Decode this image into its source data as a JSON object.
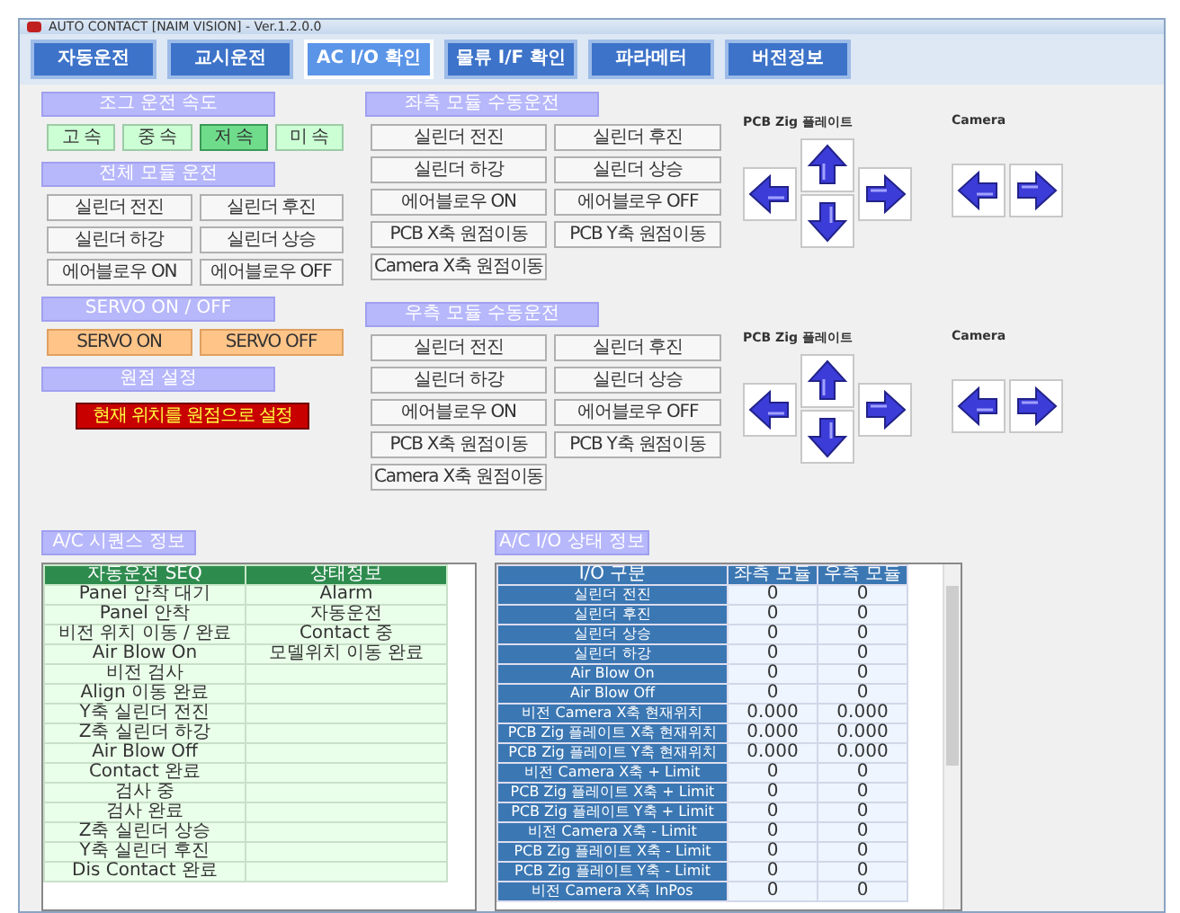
{
  "window": {
    "title": "AUTO CONTACT [NAIM VISION] - Ver.1.2.0.0"
  },
  "tabs": [
    {
      "label": "자동운전",
      "selected": false
    },
    {
      "label": "교시운전",
      "selected": false
    },
    {
      "label": "AC I/O 확인",
      "selected": true
    },
    {
      "label": "물류 I/F 확인",
      "selected": false
    },
    {
      "label": "파라메터",
      "selected": false
    },
    {
      "label": "버전정보",
      "selected": false
    }
  ],
  "jog_speed": {
    "title": "조그 운전 속도",
    "options": [
      {
        "label": "고 속",
        "selected": false
      },
      {
        "label": "중 속",
        "selected": false
      },
      {
        "label": "저 속",
        "selected": true
      },
      {
        "label": "미 속",
        "selected": false
      }
    ]
  },
  "all_module": {
    "title": "전체 모듈 운전",
    "buttons": [
      "실린더 전진",
      "실린더 후진",
      "실린더 하강",
      "실린더 상승",
      "에어블로우 ON",
      "에어블로우 OFF"
    ]
  },
  "servo": {
    "title": "SERVO ON / OFF",
    "buttons": [
      "SERVO ON",
      "SERVO OFF"
    ]
  },
  "origin": {
    "title": "원점 설정",
    "button": "현재 위치를 원점으로 설정"
  },
  "manual_modules": [
    {
      "title": "좌측 모듈 수동운전",
      "buttons": [
        "실린더 전진",
        "실린더 후진",
        "실린더 하강",
        "실린더 상승",
        "에어블로우 ON",
        "에어블로우 OFF",
        "PCB X축 원점이동",
        "PCB Y축 원점이동",
        "Camera X축 원점이동"
      ],
      "pcb_label": "PCB Zig 플레이트",
      "camera_label": "Camera"
    },
    {
      "title": "우측 모듈 수동운전",
      "buttons": [
        "실린더 전진",
        "실린더 후진",
        "실린더 하강",
        "실린더 상승",
        "에어블로우 ON",
        "에어블로우 OFF",
        "PCB X축 원점이동",
        "PCB Y축 원점이동",
        "Camera X축 원점이동"
      ],
      "pcb_label": "PCB Zig 플레이트",
      "camera_label": "Camera"
    }
  ],
  "sequence": {
    "title": "A/C 시퀀스 정보",
    "columns": [
      "자동운전 SEQ",
      "상태정보"
    ],
    "rows": [
      {
        "seq": "Panel 안착 대기",
        "status": "Alarm"
      },
      {
        "seq": "Panel 안착",
        "status": "자동운전"
      },
      {
        "seq": "비전 위치 이동 / 완료",
        "status": "Contact 중"
      },
      {
        "seq": "Air Blow On",
        "status": "모델위치 이동 완료"
      },
      {
        "seq": "비전 검사"
      },
      {
        "seq": "Align 이동 완료"
      },
      {
        "seq": "Y축 실린더 전진"
      },
      {
        "seq": "Z축 실린더 하강"
      },
      {
        "seq": "Air Blow Off"
      },
      {
        "seq": "Contact 완료"
      },
      {
        "seq": "검사 중"
      },
      {
        "seq": "검사 완료"
      },
      {
        "seq": "Z축 실린더 상승"
      },
      {
        "seq": "Y축 실린더 후진"
      },
      {
        "seq": "Dis Contact 완료"
      }
    ]
  },
  "io_status": {
    "title": "A/C I/O 상태 정보",
    "columns": [
      "I/O 구분",
      "좌측 모듈",
      "우측 모듈"
    ],
    "rows": [
      [
        "실린더 전진",
        "0",
        "0"
      ],
      [
        "실린더 후진",
        "0",
        "0"
      ],
      [
        "실린더 상승",
        "0",
        "0"
      ],
      [
        "실린더 하강",
        "0",
        "0"
      ],
      [
        "Air Blow On",
        "0",
        "0"
      ],
      [
        "Air Blow Off",
        "0",
        "0"
      ],
      [
        "비전 Camera X축 현재위치",
        "0.000",
        "0.000"
      ],
      [
        "PCB Zig 플레이트 X축 현재위치",
        "0.000",
        "0.000"
      ],
      [
        "PCB Zig 플레이트 Y축 현재위치",
        "0.000",
        "0.000"
      ],
      [
        "비전 Camera X축 + Limit",
        "0",
        "0"
      ],
      [
        "PCB Zig 플레이트 X축 + Limit",
        "0",
        "0"
      ],
      [
        "PCB Zig 플레이트 Y축 + Limit",
        "0",
        "0"
      ],
      [
        "비전 Camera X축 - Limit",
        "0",
        "0"
      ],
      [
        "PCB Zig 플레이트 X축 - Limit",
        "0",
        "0"
      ],
      [
        "PCB Zig 플레이트 Y축 - Limit",
        "0",
        "0"
      ],
      [
        "비전 Camera X축 InPos",
        "0",
        "0"
      ]
    ]
  }
}
